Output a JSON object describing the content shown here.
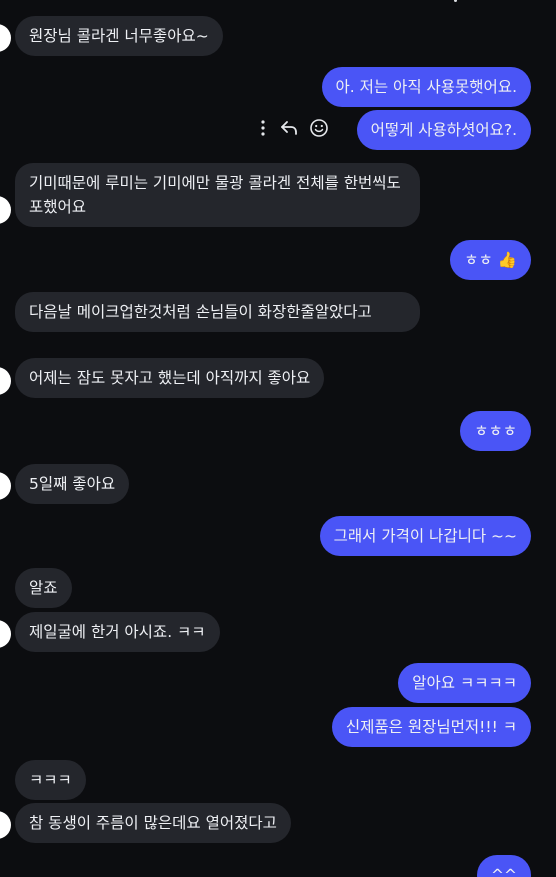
{
  "conversation": {
    "messages": [
      {
        "id": "m1",
        "side": "in",
        "text": "원장님 콜라겐 너무좋아요~"
      },
      {
        "id": "m2",
        "side": "out",
        "text": "아. 저는 아직  사용못햇어요."
      },
      {
        "id": "m3",
        "side": "out",
        "text": "어떻게 사용하셧어요?."
      },
      {
        "id": "m4",
        "side": "in",
        "text": "기미때문에 루미는 기미에만 물광 콜라겐 전체를 한번씩도포했어요"
      },
      {
        "id": "m5",
        "side": "out",
        "text": "ㅎㅎ 👍"
      },
      {
        "id": "m6",
        "side": "in",
        "text": "다음날 메이크업한것처럼 손님들이 화장한줄알았다고"
      },
      {
        "id": "m7",
        "side": "in",
        "text": "어제는 잠도 못자고 했는데 아직까지 좋아요"
      },
      {
        "id": "m8",
        "side": "out",
        "text": "ㅎㅎㅎ"
      },
      {
        "id": "m9",
        "side": "in",
        "text": "5일째 좋아요"
      },
      {
        "id": "m10",
        "side": "out",
        "text": "그래서 가격이 나갑니다 ~~"
      },
      {
        "id": "m11",
        "side": "in",
        "text": "알죠"
      },
      {
        "id": "m12",
        "side": "in",
        "text": "제일굴에 한거 아시죠. ㅋㅋ"
      },
      {
        "id": "m13",
        "side": "out",
        "text": "알아요 ㅋㅋㅋㅋ"
      },
      {
        "id": "m14",
        "side": "out",
        "text": "신제품은  원장님먼저!!! ㅋ"
      },
      {
        "id": "m15",
        "side": "in",
        "text": "ㅋㅋㅋ"
      },
      {
        "id": "m16",
        "side": "in",
        "text": "참 동생이 주름이 많은데요 열어졌다고"
      },
      {
        "id": "m17",
        "side": "out",
        "text": "^^"
      }
    ]
  },
  "message_actions": {
    "icons": [
      "more-vertical-icon",
      "reply-icon",
      "emoji-reaction-icon"
    ]
  },
  "colors": {
    "background": "#0c0d10",
    "incoming_bubble": "#24262c",
    "outgoing_bubble": "#4a55f6",
    "text": "#eef0f4",
    "avatar": "#ffffff"
  }
}
